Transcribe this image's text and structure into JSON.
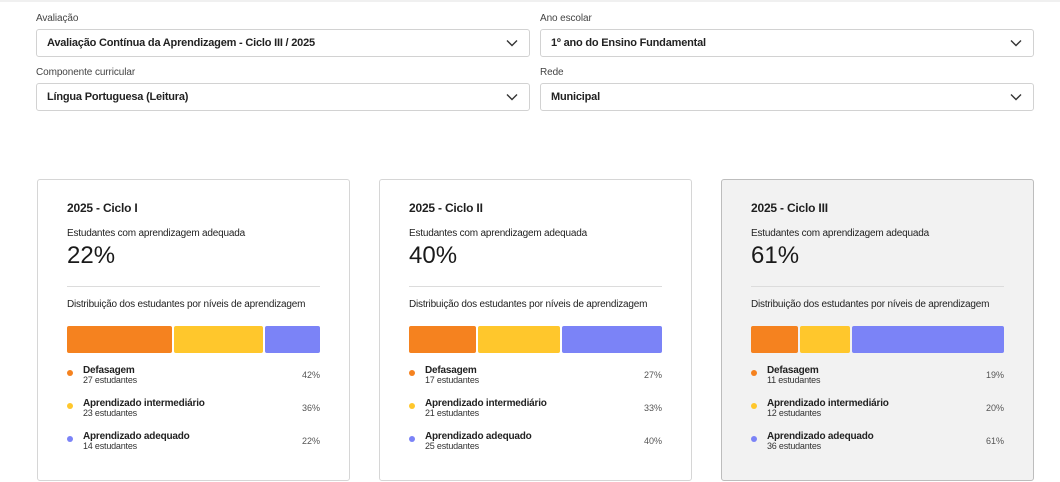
{
  "filters": {
    "avaliacao": {
      "label": "Avaliação",
      "value": "Avaliação Contínua da Aprendizagem - Ciclo III / 2025"
    },
    "ano": {
      "label": "Ano escolar",
      "value": "1º ano do Ensino Fundamental"
    },
    "componente": {
      "label": "Componente curricular",
      "value": "Língua Portuguesa (Leitura)"
    },
    "rede": {
      "label": "Rede",
      "value": "Municipal"
    }
  },
  "colors": {
    "defasagem": "#f5821f",
    "intermediario": "#ffc72c",
    "adequado": "#7b83f7"
  },
  "cards": [
    {
      "title": "2025 - Ciclo I",
      "subtitle": "Estudantes com aprendizagem adequada",
      "percent": "22%",
      "dist_title": "Distribuição dos estudantes por níveis de aprendizagem",
      "selected": false,
      "levels": [
        {
          "name": "Defasagem",
          "count": "27 estudantes",
          "pct": "42%",
          "share": 42
        },
        {
          "name": "Aprendizado intermediário",
          "count": "23 estudantes",
          "pct": "36%",
          "share": 36
        },
        {
          "name": "Aprendizado adequado",
          "count": "14 estudantes",
          "pct": "22%",
          "share": 22
        }
      ]
    },
    {
      "title": "2025 - Ciclo II",
      "subtitle": "Estudantes com aprendizagem adequada",
      "percent": "40%",
      "dist_title": "Distribuição dos estudantes por níveis de aprendizagem",
      "selected": false,
      "levels": [
        {
          "name": "Defasagem",
          "count": "17 estudantes",
          "pct": "27%",
          "share": 27
        },
        {
          "name": "Aprendizado intermediário",
          "count": "21 estudantes",
          "pct": "33%",
          "share": 33
        },
        {
          "name": "Aprendizado adequado",
          "count": "25 estudantes",
          "pct": "40%",
          "share": 40
        }
      ]
    },
    {
      "title": "2025 - Ciclo III",
      "subtitle": "Estudantes com aprendizagem adequada",
      "percent": "61%",
      "dist_title": "Distribuição dos estudantes por níveis de aprendizagem",
      "selected": true,
      "levels": [
        {
          "name": "Defasagem",
          "count": "11 estudantes",
          "pct": "19%",
          "share": 19
        },
        {
          "name": "Aprendizado intermediário",
          "count": "12 estudantes",
          "pct": "20%",
          "share": 20
        },
        {
          "name": "Aprendizado adequado",
          "count": "36 estudantes",
          "pct": "61%",
          "share": 61
        }
      ]
    }
  ]
}
